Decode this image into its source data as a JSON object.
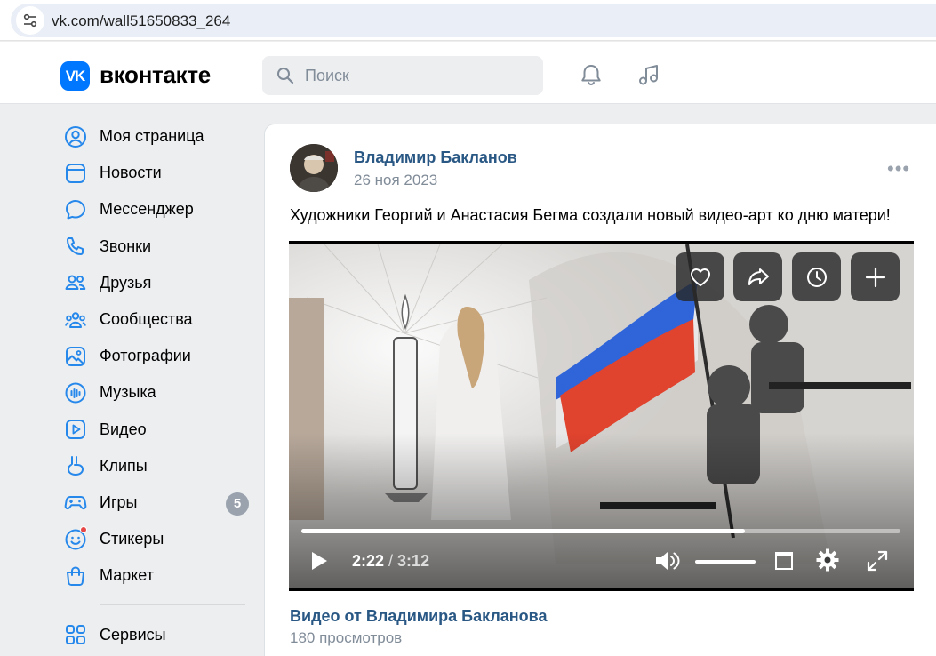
{
  "browser": {
    "url": "vk.com/wall51650833_264",
    "site_info_icon": "tune-icon"
  },
  "header": {
    "logo_mark": "VK",
    "logo_text": "вконтакте",
    "search_placeholder": "Поиск",
    "icons": [
      "bell-icon",
      "music-note-icon"
    ]
  },
  "sidebar": {
    "items": [
      {
        "label": "Моя страница",
        "icon": "user-circle-icon"
      },
      {
        "label": "Новости",
        "icon": "news-icon"
      },
      {
        "label": "Мессенджер",
        "icon": "message-bubble-icon"
      },
      {
        "label": "Звонки",
        "icon": "phone-icon"
      },
      {
        "label": "Друзья",
        "icon": "friends-icon"
      },
      {
        "label": "Сообщества",
        "icon": "communities-icon"
      },
      {
        "label": "Фотографии",
        "icon": "photo-icon"
      },
      {
        "label": "Музыка",
        "icon": "music-icon"
      },
      {
        "label": "Видео",
        "icon": "video-icon"
      },
      {
        "label": "Клипы",
        "icon": "clips-icon"
      },
      {
        "label": "Игры",
        "icon": "gamepad-icon",
        "badge": "5"
      },
      {
        "label": "Стикеры",
        "icon": "smile-icon"
      },
      {
        "label": "Маркет",
        "icon": "bag-icon"
      }
    ],
    "services": {
      "label": "Сервисы",
      "icon": "apps-grid-icon"
    }
  },
  "post": {
    "author": "Владимир Бакланов",
    "date": "26 ноя 2023",
    "text": "Художники Георгий и Анастасия Бегма создали новый видео-арт ко дню матери!",
    "video": {
      "current_time": "2:22",
      "separator": " / ",
      "total_time": "3:12",
      "progress_fraction": 0.74,
      "overlay_buttons": [
        "heart-icon",
        "share-icon",
        "clock-icon",
        "plus-icon"
      ],
      "title": "Видео от Владимира Бакланова",
      "views": "180 просмотров"
    }
  },
  "colors": {
    "accent": "#0077ff",
    "link": "#2a5885",
    "muted": "#818c99",
    "page_bg": "#edeef0"
  }
}
